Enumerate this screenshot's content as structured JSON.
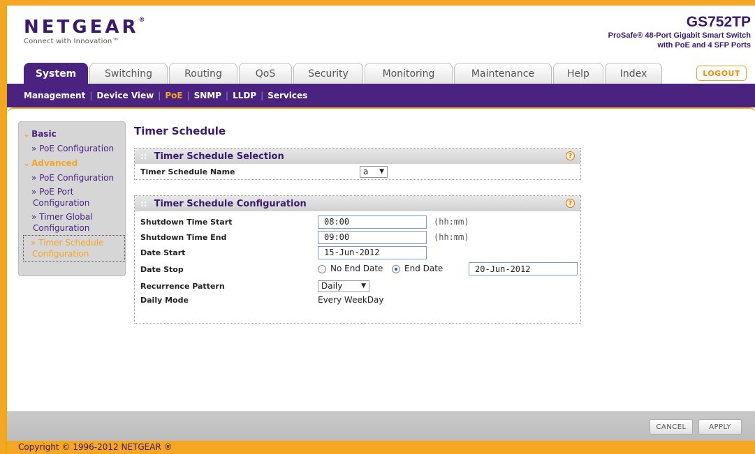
{
  "header": {
    "logo_text": "NETGEAR",
    "logo_reg": "®",
    "tagline": "Connect with Innovation™",
    "model": "GS752TP",
    "desc_line1": "ProSafe® 48-Port Gigabit Smart Switch",
    "desc_line2": "with PoE and 4 SFP Ports"
  },
  "tabs": [
    "System",
    "Switching",
    "Routing",
    "QoS",
    "Security",
    "Monitoring",
    "Maintenance",
    "Help",
    "Index"
  ],
  "logout_label": "LOGOUT",
  "submenu": [
    "Management",
    "Device View",
    "PoE",
    "SNMP",
    "LLDP",
    "Services"
  ],
  "leftnav": {
    "basic": "Basic",
    "basic_poe_config": "» PoE Configuration",
    "advanced": "Advanced",
    "adv_poe_config": "» PoE Configuration",
    "adv_poe_port_1": "» PoE Port",
    "adv_poe_port_2": "Configuration",
    "adv_timer_global_1": "» Timer Global",
    "adv_timer_global_2": "Configuration",
    "adv_timer_schedule_1": "» Timer Schedule",
    "adv_timer_schedule_2": "Configuration"
  },
  "page": {
    "title": "Timer Schedule",
    "selection_title": "Timer Schedule Selection",
    "schedule_name_label": "Timer Schedule Name",
    "schedule_name_value": "a",
    "config_title": "Timer Schedule Configuration",
    "shutdown_start_label": "Shutdown Time Start",
    "shutdown_start_value": "08:00",
    "shutdown_end_label": "Shutdown Time End",
    "shutdown_end_value": "09:00",
    "time_unit": "(hh:mm)",
    "date_start_label": "Date Start",
    "date_start_value": "15-Jun-2012",
    "date_stop_label": "Date Stop",
    "no_end_date_label": "No End Date",
    "end_date_label": "End Date",
    "end_date_value": "20-Jun-2012",
    "recurrence_label": "Recurrence Pattern",
    "recurrence_value": "Daily",
    "daily_mode_label": "Daily Mode",
    "daily_mode_value": "Every WeekDay"
  },
  "buttons": {
    "cancel": "CANCEL",
    "apply": "APPLY"
  },
  "footer": {
    "copyright": "Copyright © 1996-2012 NETGEAR ®"
  }
}
